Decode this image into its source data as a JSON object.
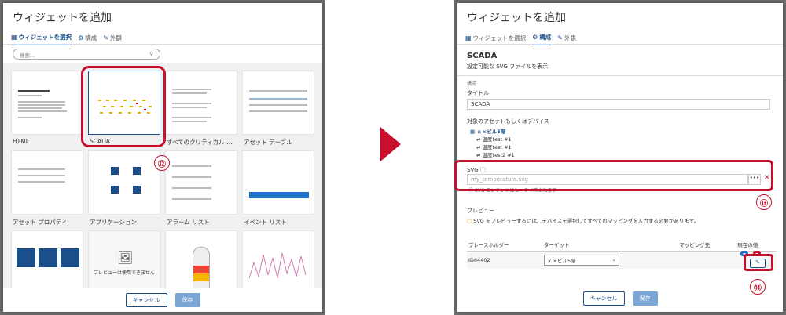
{
  "left": {
    "title": "ウィジェットを追加",
    "tabs": [
      {
        "label": "ウィジェットを選択",
        "icon": "grid-icon"
      },
      {
        "label": "構成",
        "icon": "gear-icon"
      },
      {
        "label": "外観",
        "icon": "brush-icon"
      }
    ],
    "search_placeholder": "検索…",
    "cards": [
      {
        "label": "HTML"
      },
      {
        "label": "SCADA"
      },
      {
        "label": "すべてのクリティカル …"
      },
      {
        "label": "アセット テーブル"
      },
      {
        "label": "アセット プロパティ"
      },
      {
        "label": "アプリケーション"
      },
      {
        "label": "アラーム リスト"
      },
      {
        "label": "イベント リスト"
      },
      {
        "label": ""
      },
      {
        "label": "プレビューは使用できません"
      },
      {
        "label": ""
      },
      {
        "label": ""
      }
    ],
    "callout": "⑫",
    "cancel_label": "キャンセル",
    "save_label": "保存"
  },
  "right": {
    "title": "ウィジェットを追加",
    "tabs": [
      {
        "label": "ウィジェットを選択",
        "icon": "grid-icon"
      },
      {
        "label": "構成",
        "icon": "gear-icon"
      },
      {
        "label": "外観",
        "icon": "brush-icon"
      }
    ],
    "widget_name": "SCADA",
    "widget_desc": "設定可能な SVG ファイルを表示",
    "section_label": "構成",
    "title_label": "タイトル",
    "title_value": "SCADA",
    "devices_label": "対象のアセットもしくはデバイス",
    "tree_root": "ｘｘビル5階",
    "tree_children": [
      "温度test #1",
      "温度test #1",
      "温度test2 #1"
    ],
    "svg_label": "SVG",
    "svg_value": "my_temperature.svg",
    "svg_hint": "SVG コンテンツはヒーライズされます",
    "preview_label": "プレビュー",
    "preview_note": "SVG をプレビューするには、デバイスを選択してすべてのマッピングを入力する必要があります。",
    "columns": [
      "プレースホルダー",
      "ターゲット",
      "マッピング先",
      "現在の値"
    ],
    "row_placeholder": "ID84402",
    "row_target": "ｘｘビル5階",
    "callout_13": "⑬",
    "callout_14": "⑭",
    "cancel_label": "キャンセル",
    "save_label": "保存"
  },
  "colors": {
    "accent": "#1a4f8b",
    "highlight": "#c8102e",
    "primary_btn": "#7aa5d4"
  }
}
